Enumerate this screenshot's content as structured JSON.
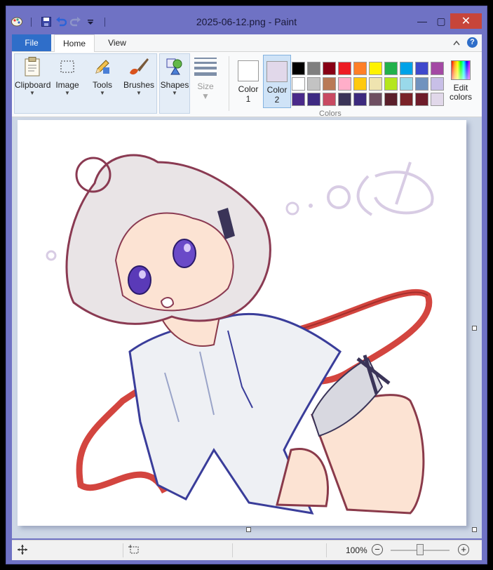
{
  "window": {
    "title": "2025-06-12.png - Paint",
    "close_glyph": "✕",
    "min_glyph": "—",
    "max_glyph": "▢"
  },
  "tabs": {
    "file": "File",
    "home": "Home",
    "view": "View"
  },
  "ribbon": {
    "clipboard": "Clipboard",
    "image": "Image",
    "tools": "Tools",
    "brushes": "Brushes",
    "shapes": "Shapes",
    "size": "Size",
    "color1": "Color\n1",
    "color1_line1": "Color",
    "color1_line2": "1",
    "color2_line1": "Color",
    "color2_line2": "2",
    "edit_colors_line1": "Edit",
    "edit_colors_line2": "colors",
    "colors_group": "Colors"
  },
  "colors": {
    "color1": "#ffffff",
    "color2": "#e1d8ea",
    "palette": [
      "#000000",
      "#7f7f7f",
      "#880015",
      "#ed1c24",
      "#ff7f27",
      "#fff200",
      "#22b14c",
      "#00a2e8",
      "#3f48cc",
      "#a349a4",
      "#ffffff",
      "#c3c3c3",
      "#b97a57",
      "#ffaec9",
      "#ffc90e",
      "#efe4b0",
      "#b5e61d",
      "#99d9ea",
      "#7092be",
      "#c8bfe7",
      "#4a2a8a",
      "#3e2a82",
      "#c84a62",
      "#3a3458",
      "#3c2a7e",
      "#6e4f62",
      "#5a1f2a",
      "#7a2228",
      "#6e1c2a",
      "#e1d8ea"
    ]
  },
  "status": {
    "zoom": "100%"
  }
}
